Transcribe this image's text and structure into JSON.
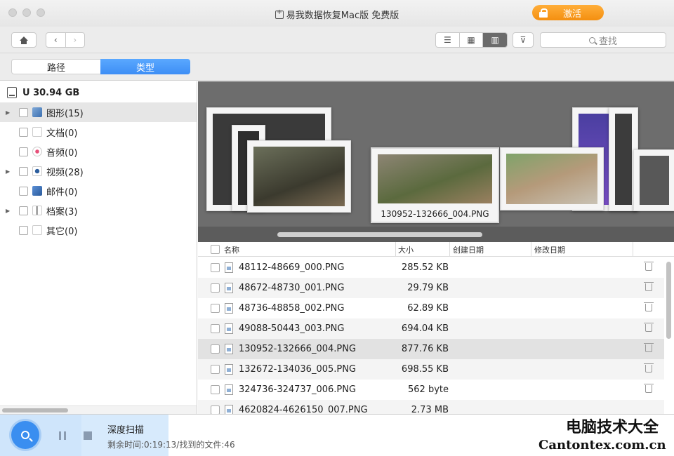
{
  "window": {
    "title": "易我数据恢复Mac版 免费版"
  },
  "activate_label": "激活",
  "toolbar": {
    "search_placeholder": "查找"
  },
  "tabs": [
    {
      "label": "路径"
    },
    {
      "label": "类型"
    }
  ],
  "drive": {
    "label": "U 30.94 GB"
  },
  "tree": [
    {
      "label": "图形(15)",
      "expandable": true,
      "selected": true,
      "icon": "image-icon"
    },
    {
      "label": "文档(0)",
      "expandable": false,
      "icon": "document-icon"
    },
    {
      "label": "音频(0)",
      "expandable": false,
      "icon": "audio-icon"
    },
    {
      "label": "视频(28)",
      "expandable": true,
      "icon": "video-icon"
    },
    {
      "label": "邮件(0)",
      "expandable": false,
      "icon": "mail-icon"
    },
    {
      "label": "档案(3)",
      "expandable": true,
      "icon": "archive-icon"
    },
    {
      "label": "其它(0)",
      "expandable": false,
      "icon": "other-icon"
    }
  ],
  "gallery": {
    "selected_caption": "130952-132666_004.PNG"
  },
  "columns": {
    "name": "名称",
    "size": "大小",
    "created": "创建日期",
    "modified": "修改日期"
  },
  "files": [
    {
      "name": "48112-48669_000.PNG",
      "size": "285.52 KB"
    },
    {
      "name": "48672-48730_001.PNG",
      "size": "29.79 KB"
    },
    {
      "name": "48736-48858_002.PNG",
      "size": "62.89 KB"
    },
    {
      "name": "49088-50443_003.PNG",
      "size": "694.04 KB"
    },
    {
      "name": "130952-132666_004.PNG",
      "size": "877.76 KB"
    },
    {
      "name": "132672-134036_005.PNG",
      "size": "698.55 KB"
    },
    {
      "name": "324736-324737_006.PNG",
      "size": "562 byte"
    },
    {
      "name": "4620824-4626150_007.PNG",
      "size": "2.73 MB"
    }
  ],
  "scan": {
    "title": "深度扫描",
    "status": "剩余时间:0:19:13/找到的文件:46"
  },
  "watermark": {
    "line1": "电脑技术大全",
    "line2": "Cantontex.com.cn"
  },
  "colors": {
    "accent": "#3d8ef5",
    "activate": "#f48f10"
  }
}
